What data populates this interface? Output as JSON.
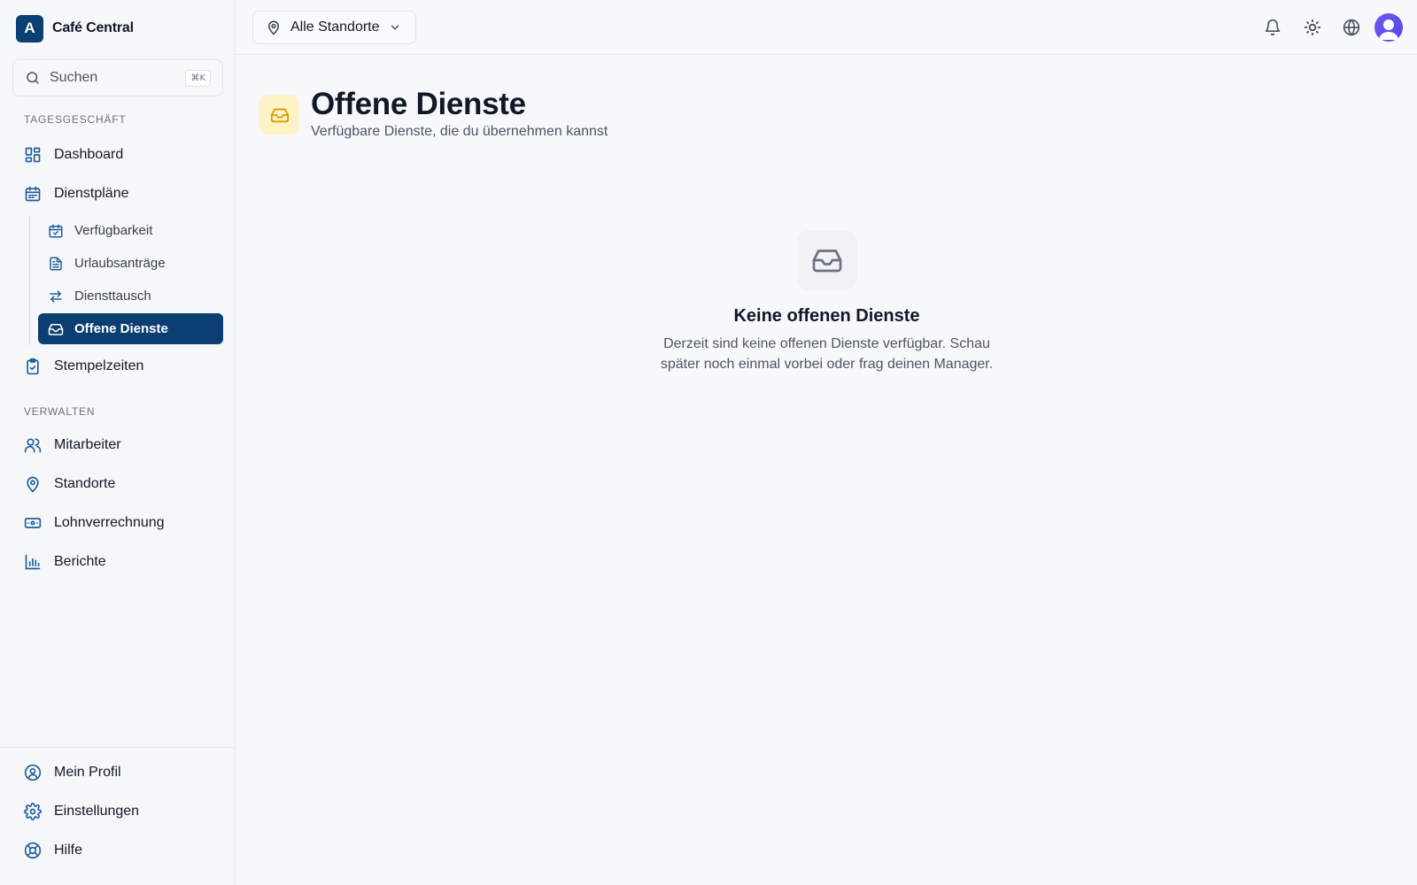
{
  "app": {
    "logo_letter": "A",
    "name": "Café Central"
  },
  "search": {
    "placeholder": "Suchen",
    "shortcut": "⌘K"
  },
  "sidebar": {
    "section_daily": "TAGESGESCHÄFT",
    "dashboard": "Dashboard",
    "schedules": "Dienstpläne",
    "sub_items": [
      {
        "label": "Verfügbarkeit",
        "icon": "calendar-check-icon"
      },
      {
        "label": "Urlaubsanträge",
        "icon": "file-text-icon"
      },
      {
        "label": "Diensttausch",
        "icon": "swap-arrows-icon"
      },
      {
        "label": "Offene Dienste",
        "icon": "inbox-icon",
        "active": true
      }
    ],
    "timesheets": "Stempelzeiten",
    "section_manage": "VERWALTEN",
    "employees": "Mitarbeiter",
    "locations": "Standorte",
    "payroll": "Lohnverrechnung",
    "reports": "Berichte",
    "profile": "Mein Profil",
    "settings": "Einstellungen",
    "help": "Hilfe"
  },
  "topbar": {
    "location_select": "Alle Standorte"
  },
  "page": {
    "title": "Offene Dienste",
    "subtitle": "Verfügbare Dienste, die du übernehmen kannst"
  },
  "empty_state": {
    "title": "Keine offenen Dienste",
    "text": "Derzeit sind keine offenen Dienste verfügbar. Schau später noch einmal vorbei oder frag deinen Manager."
  },
  "colors": {
    "brand": "#0b3f72",
    "nav_icon": "#1d5f9e",
    "page_icon_bg": "#fef3c7",
    "page_icon": "#d99a06"
  }
}
